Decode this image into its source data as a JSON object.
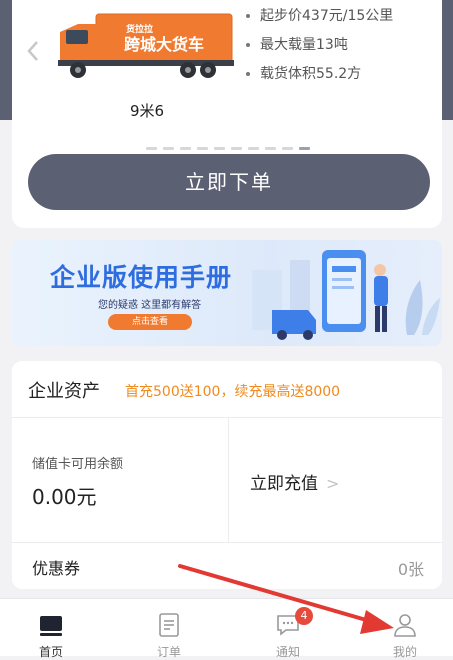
{
  "vehicle": {
    "name": "9米6",
    "truck_slogan": "跨城大货车",
    "truck_brand": "货拉拉",
    "specs": [
      "起步价437元/15公里",
      "最大载量13吨",
      "载货体积55.2方"
    ],
    "carousel_total": 10,
    "carousel_active": 10,
    "order_button": "立即下单"
  },
  "banner": {
    "title": "企业版使用手册",
    "subtitle": "您的疑惑 这里都有解答",
    "cta": "点击查看"
  },
  "assets": {
    "title": "企业资产",
    "promo": "首充500送100，续充最高送8000",
    "balance_label": "储值卡可用余额",
    "balance_value": "0.00元",
    "recharge_label": "立即充值",
    "coupon_label": "优惠券",
    "coupon_count": "0张"
  },
  "tabbar": {
    "tabs": [
      {
        "label": "首页",
        "icon": "home-icon",
        "active": true
      },
      {
        "label": "订单",
        "icon": "order-list-icon",
        "active": false
      },
      {
        "label": "通知",
        "icon": "message-icon",
        "active": false,
        "badge": "4"
      },
      {
        "label": "我的",
        "icon": "user-icon",
        "active": false
      }
    ]
  },
  "colors": {
    "header": "#5b6073",
    "promo": "#f08a1e",
    "badge": "#e64a3b",
    "arrow": "#e23a32",
    "banner_title": "#2e6de0"
  }
}
